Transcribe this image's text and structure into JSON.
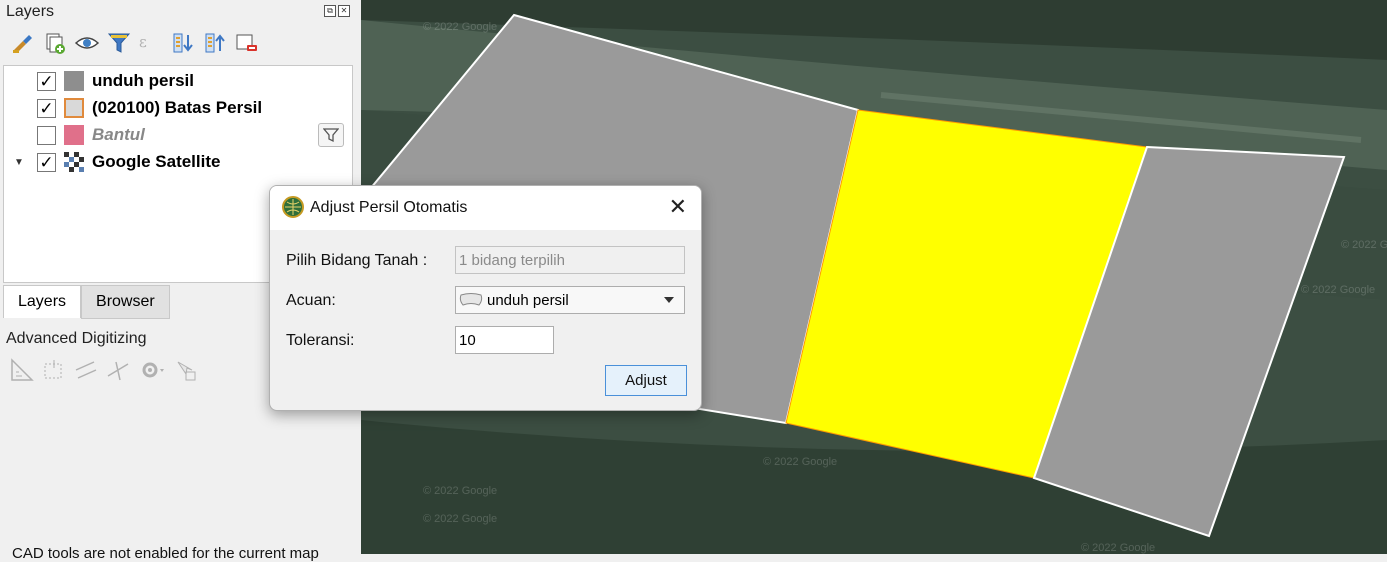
{
  "layers_panel": {
    "title": "Layers",
    "dock_float": "⧉",
    "dock_close": "✕",
    "toolbar_icons": [
      "style-manager-icon",
      "add-group-icon",
      "visibility-eye-icon",
      "filter-legend-icon",
      "filter-expression-icon",
      "expand-all-icon",
      "collapse-all-icon",
      "remove-layer-icon"
    ],
    "layers": [
      {
        "name": "unduh persil",
        "checked": true,
        "symbol_color": "#8e8e8e",
        "bold": true
      },
      {
        "name": "(020100) Batas Persil",
        "checked": true,
        "symbol_color": "#d9d9d9",
        "symbol_border": "#e08a3c",
        "bold": true
      },
      {
        "name": "Bantul",
        "checked": false,
        "symbol_color": "#e0708a",
        "italic": true
      },
      {
        "name": "Google Satellite",
        "checked": true,
        "expandable": true,
        "raster": true,
        "bold": true
      }
    ],
    "check_mark": "✓",
    "expander": "▼",
    "tabs": [
      "Layers",
      "Browser"
    ]
  },
  "advanced_digitizing": {
    "title": "Advanced Digitizing",
    "message": "CAD tools are not enabled for the current map"
  },
  "dialog": {
    "title": "Adjust Persil Otomatis",
    "close": "✕",
    "fields": {
      "pilih_label": "Pilih Bidang Tanah :",
      "pilih_value": "1 bidang terpilih",
      "acuan_label": "Acuan:",
      "acuan_value": "unduh persil",
      "toleransi_label": "Toleransi:",
      "toleransi_value": "10"
    },
    "adjust_button": "Adjust"
  },
  "map": {
    "watermark": "© 2022 Google",
    "parcel_fill_gray": "#9a9a9a",
    "parcel_fill_selected": "#ffff00",
    "parcel_stroke": "#ffffff"
  }
}
